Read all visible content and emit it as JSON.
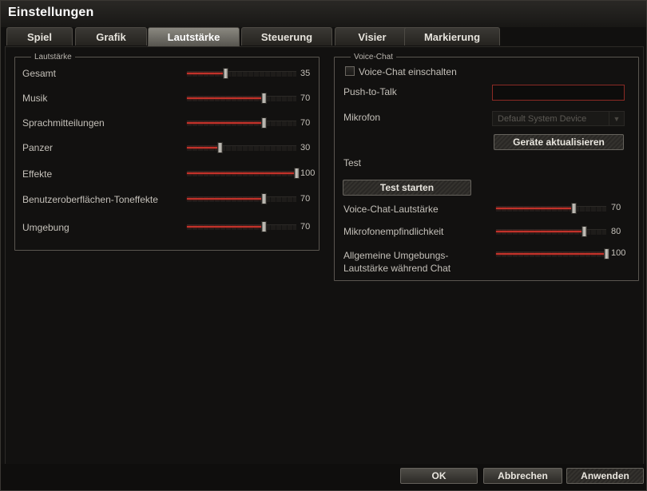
{
  "window": {
    "title": "Einstellungen"
  },
  "tabs": [
    {
      "label": "Spiel",
      "active": false
    },
    {
      "label": "Grafik",
      "active": false
    },
    {
      "label": "Lautstärke",
      "active": true
    },
    {
      "label": "Steuerung",
      "active": false
    },
    {
      "label": "Visier",
      "active": false
    },
    {
      "label": "Markierung",
      "active": false
    }
  ],
  "volume": {
    "legend": "Lautstärke",
    "rows": [
      {
        "label": "Gesamt",
        "value": 35
      },
      {
        "label": "Musik",
        "value": 70
      },
      {
        "label": "Sprachmitteilungen",
        "value": 70
      },
      {
        "label": "Panzer",
        "value": 30
      },
      {
        "label": "Effekte",
        "value": 100
      },
      {
        "label": "Benutzeroberflächen-Toneffekte",
        "value": 70
      },
      {
        "label": "Umgebung",
        "value": 70
      }
    ]
  },
  "voice_chat": {
    "legend": "Voice-Chat",
    "enable_label": "Voice-Chat einschalten",
    "enabled": false,
    "push_to_talk_label": "Push-to-Talk",
    "push_to_talk_value": "",
    "microphone_label": "Mikrofon",
    "microphone_selected": "Default System Device",
    "refresh_devices_label": "Geräte aktualisieren",
    "test_label": "Test",
    "test_button_label": "Test starten",
    "sliders": [
      {
        "label": "Voice-Chat-Lautstärke",
        "value": 70
      },
      {
        "label": "Mikrofonempfindlichkeit",
        "value": 80
      },
      {
        "label_line1": "Allgemeine Umgebungs-",
        "label_line2": "Lautstärke während Chat",
        "value": 100
      }
    ]
  },
  "footer": {
    "ok_label": "OK",
    "cancel_label": "Abbrechen",
    "apply_label": "Anwenden"
  },
  "colors": {
    "accent_red": "#c2322a",
    "background": "#121110",
    "active_tab": "#8a8880"
  }
}
